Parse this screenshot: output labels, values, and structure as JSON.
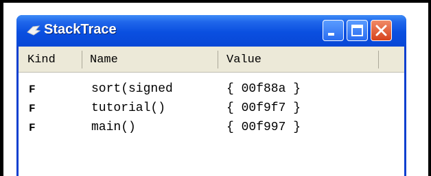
{
  "window": {
    "title": "StackTrace",
    "icon": "java-cup-icon",
    "controls": [
      "minimize-icon",
      "maximize-icon",
      "close-icon"
    ],
    "colors": {
      "titlebar": "#0a4fe0",
      "close": "#d6421c",
      "header_bg": "#ece9d8"
    }
  },
  "table": {
    "columns": [
      "Kind",
      "Name",
      "Value"
    ],
    "rows": [
      {
        "kind": "F",
        "name": "sort(signed",
        "value": "{ 00f88a }"
      },
      {
        "kind": "F",
        "name": "tutorial()",
        "value": "{ 00f9f7 }"
      },
      {
        "kind": "F",
        "name": "main()",
        "value": "{ 00f997 }"
      }
    ]
  }
}
